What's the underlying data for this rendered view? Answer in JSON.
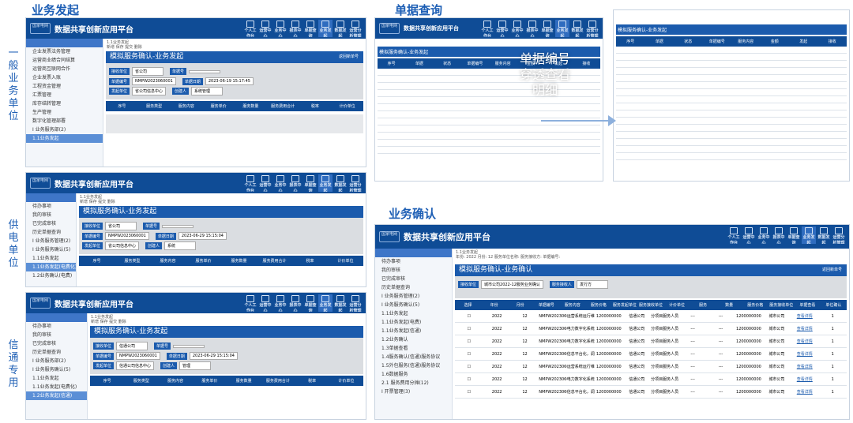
{
  "sections": {
    "s1": "业务发起",
    "s2": "单据查询",
    "s3": "业务确认"
  },
  "side_labels": {
    "a": "一般业务单位",
    "b": "供电单位",
    "c": "信通专用"
  },
  "center_label": "单据编号穿透查看明细",
  "app_title": "数据共享创新应用平台",
  "logo_text": "国家电网",
  "header_icons": [
    "个人工作台",
    "运营中心",
    "业务中心",
    "报表中心",
    "单据查询",
    "业务发起",
    "数据发起",
    "运营分析管理中心"
  ],
  "win1": {
    "breadcrumb": "1.1业务发起",
    "toolbar": "新增  保存  提交  删除",
    "bar_title": "模拟服务确认-业务发起",
    "bar_right": "返回新单号",
    "fields": [
      [
        "接收单位",
        "省公司",
        "单据号",
        ""
      ],
      [
        "单据编号",
        "NMPW2023060001",
        "单据日期",
        "2023-06-19 15:17:45"
      ],
      [
        "发起单位",
        "省公司信息中心",
        "创建人",
        "系统管理"
      ]
    ],
    "cols": [
      "序号",
      "服务类型",
      "服务内容",
      "服务单价",
      "服务数量",
      "服务费用合计",
      "税率",
      "计价单位"
    ],
    "sidebar": [
      "企业发票法务管理",
      "运营商业绩合同结算",
      "运营商互联网合作",
      "企业发票入账",
      "工程资金管理",
      "汇票管理",
      "库存结转管理",
      "生产管理",
      "数字化管理部署",
      "I 业务服务部(2)",
      "1.1业务发起"
    ]
  },
  "win2": {
    "bar_title": "模拟服务确认-业务发起",
    "fields": [
      [
        "接收单位",
        "省公司",
        "单据号",
        ""
      ],
      [
        "单据编号",
        "NMPW2023060001",
        "单据日期",
        "2023-06-29 15:15:04"
      ],
      [
        "发起单位",
        "省公司信息中心",
        "创建人",
        "系统"
      ]
    ],
    "sidebar": [
      "待办事项",
      "我的审核",
      "已完成审核",
      "历史单据查询",
      "I 业务服务管理(2)",
      "I 业务服务确认(5)",
      "1.1业务发起",
      "1.1业务发起(电费化)",
      "1.2业务确认(电费)"
    ]
  },
  "win3": {
    "bar_title": "模拟服务确认-业务发起",
    "fields": [
      [
        "接收单位",
        "信通公司",
        "单据号",
        ""
      ],
      [
        "单据编号",
        "NMPW2023060001",
        "单据日期",
        "2023-06-29 15:15:04"
      ],
      [
        "发起单位",
        "信通公司信息中心",
        "创建人",
        "管理"
      ]
    ],
    "sidebar": [
      "待办事项",
      "我的审核",
      "已完成审核",
      "历史单据查询",
      "I 业务服务部(2)",
      "I 业务服务确认(5)",
      "1.1业务发起",
      "1.1业务发起(电费化)",
      "1.2业务发起(信通)"
    ]
  },
  "win4": {
    "bar_title": "模拟服务确认-业务确认",
    "bar_right": "返回新单号",
    "filter": "年份: 2022  月份: 12  服务单位名称:  服务接收方:  单据编号:",
    "fields": [
      "接收单位",
      "城市公司2022-12服务业务确认",
      "服务接收人",
      "发行方"
    ],
    "cols": [
      "选择",
      "年份",
      "月份",
      "单据编号",
      "服务内容",
      "服务价格",
      "服务发起单位",
      "服务接收单位",
      "计价单位",
      "服务",
      "数量",
      "服务价格",
      "服务接收单位",
      "单据查看",
      "单位确认"
    ],
    "rows": [
      [
        "2022",
        "12",
        "NMPW2023060001-12",
        "运营系统运行维护",
        "1200000000",
        "信通公司",
        "分项目服务人员",
        "---",
        "---",
        "1200000000",
        "城市公司",
        "查看详情",
        "1"
      ],
      [
        "2022",
        "12",
        "NMPW2023060001-26",
        "电力数字化系统建设",
        "1200000000",
        "信通公司",
        "分项目服务人员",
        "---",
        "---",
        "1200000000",
        "城市公司",
        "查看详情",
        "1"
      ],
      [
        "2022",
        "12",
        "NMPW2023060001-24",
        "电力数字化系统建设",
        "1200000000",
        "信通公司",
        "分项目服务人员",
        "---",
        "---",
        "1200000000",
        "城市公司",
        "查看详情",
        "1"
      ],
      [
        "2022",
        "12",
        "NMPW2023060001-39",
        "信息平台化，调度数据维护",
        "1200000000",
        "信通公司",
        "分项目服务人员",
        "---",
        "---",
        "1200000000",
        "城市公司",
        "查看详情",
        "1"
      ],
      [
        "2022",
        "12",
        "NMPW2023060001-9",
        "运营系统运行维护",
        "1200000000",
        "信通公司",
        "分项目服务人员",
        "---",
        "---",
        "1200000000",
        "城市公司",
        "查看详情",
        "1"
      ],
      [
        "2022",
        "12",
        "NMPW2023060001-22",
        "电力数字化系统建设",
        "1200000000",
        "信通公司",
        "分项目服务人员",
        "---",
        "---",
        "1200000000",
        "城市公司",
        "查看详情",
        "1"
      ],
      [
        "2022",
        "12",
        "NMPW2023060001-38",
        "信息平台化，调度数据维护",
        "1200000000",
        "信通公司",
        "分项目服务人员",
        "---",
        "---",
        "1200000000",
        "城市公司",
        "查看详情",
        "1"
      ]
    ],
    "sidebar": [
      "待办事项",
      "我的审核",
      "已完成审核",
      "历史单据查询",
      "I 业务服务管理(2)",
      "I 业务服务确认(5)",
      "1.1业务发起",
      "1.1业务发起(电费)",
      "1.1业务发起(信通)",
      "1.2业务确认",
      "1.3单据查看",
      "1.4服务确认(信通)服务协议",
      "1.5外包服务(信通)服务协议",
      "1.6数据服务",
      "2.1 服务费用分摊(12)",
      "I 开票管理(3)"
    ]
  },
  "query": {
    "title": "模拟服务确认-业务发起",
    "cols": [
      "序号",
      "单据",
      "状态",
      "单据编号",
      "服务内容",
      "金额",
      "发起",
      "接收"
    ]
  }
}
